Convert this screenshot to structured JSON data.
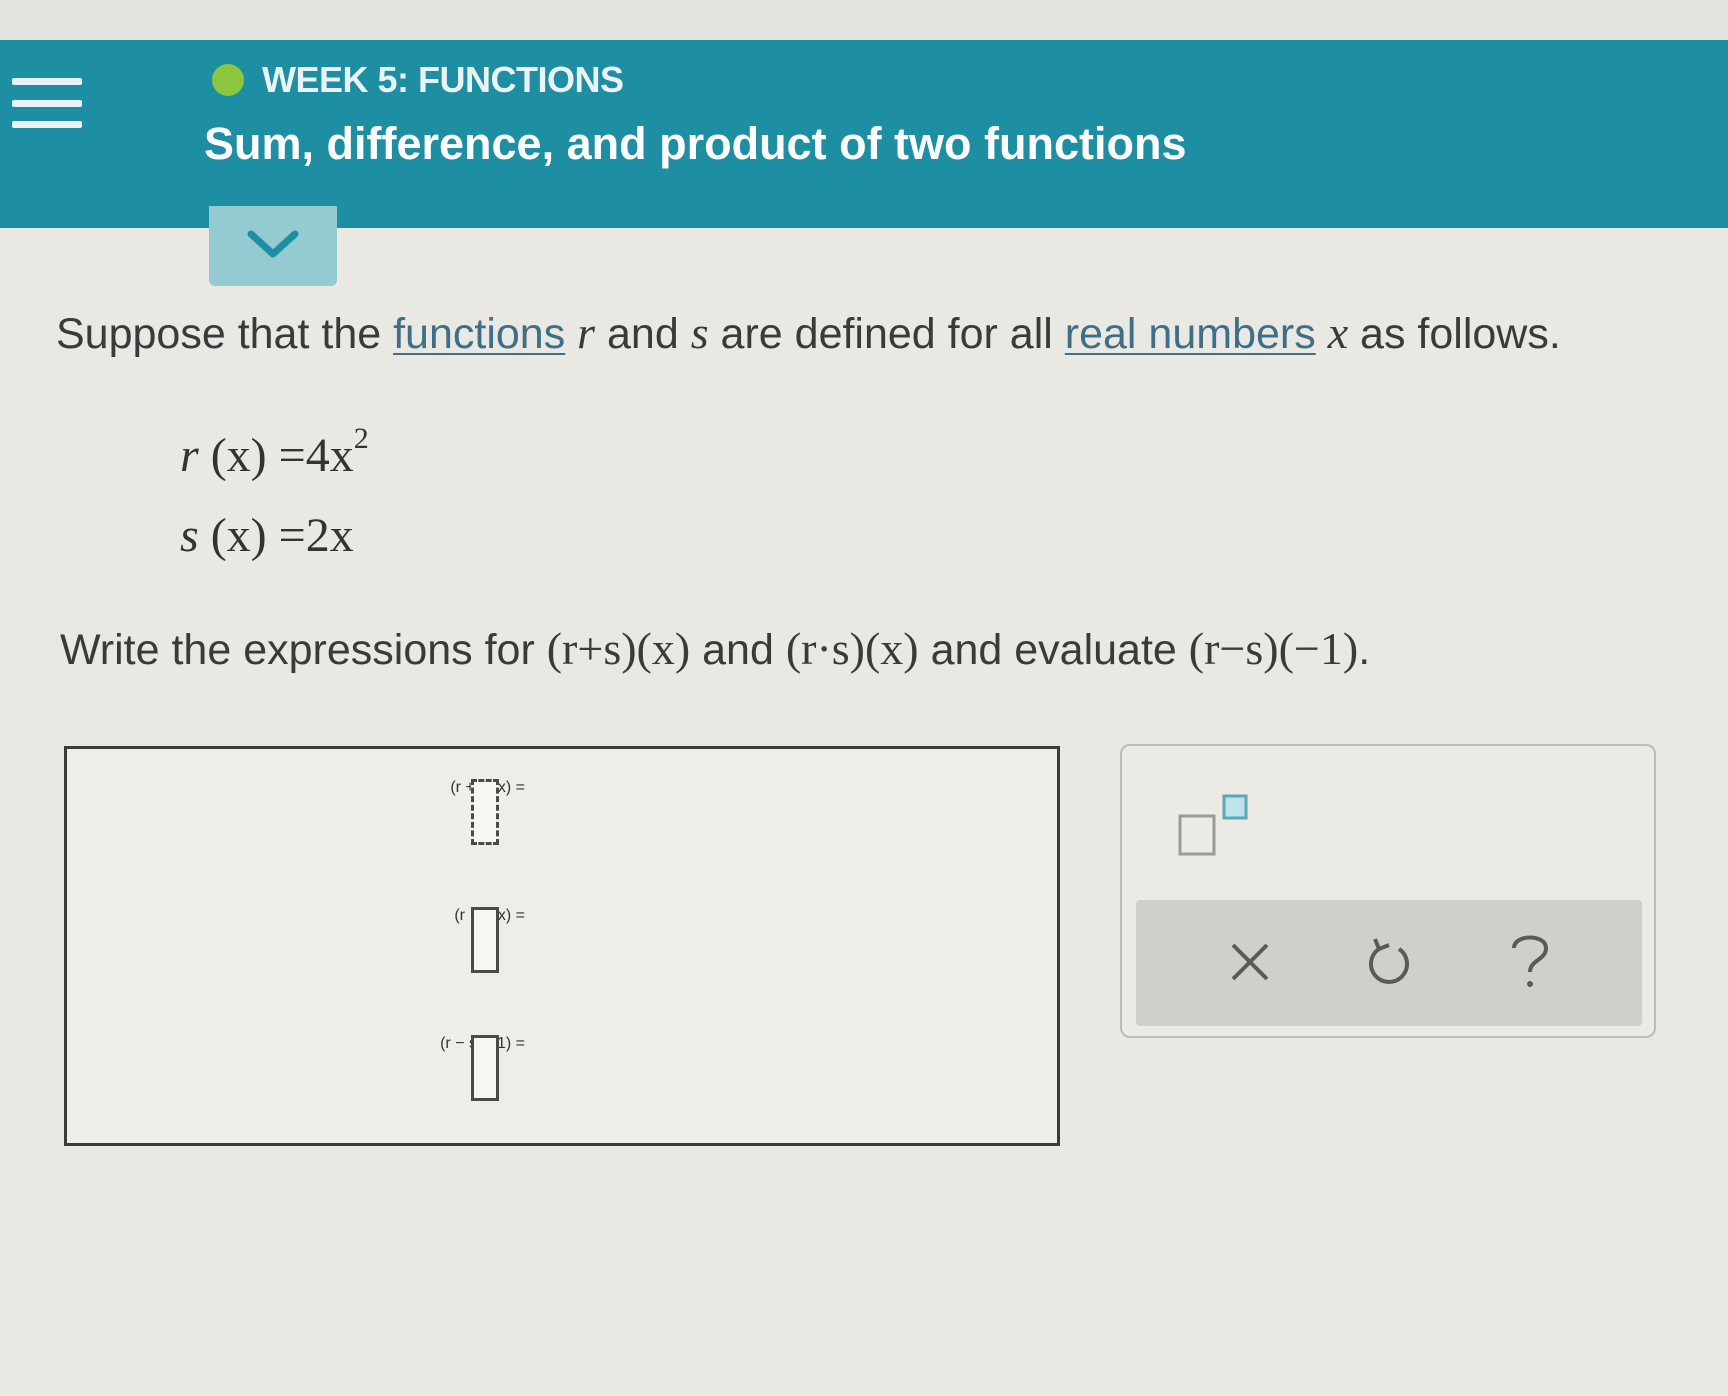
{
  "header": {
    "week_label": "WEEK 5: FUNCTIONS",
    "topic_title": "Sum, difference, and product of two functions",
    "status_color": "#8ec63f",
    "accent_color": "#1e8ea3"
  },
  "question": {
    "prompt_part1": "Suppose that the ",
    "prompt_link1": "functions",
    "prompt_var_r": "r",
    "prompt_part2": " and ",
    "prompt_var_s": "s",
    "prompt_part3": " are defined for all ",
    "prompt_link2": "real numbers",
    "prompt_var_x": "x",
    "prompt_part4": " as follows.",
    "definitions": [
      {
        "name": "r",
        "arg": "(x) =",
        "expr": "4x",
        "exponent": "2"
      },
      {
        "name": "s",
        "arg": "(x) =",
        "expr": "2x",
        "exponent": ""
      }
    ],
    "instruction_part1": "Write the expressions for ",
    "instruction_expr1": "(r+s)(x)",
    "instruction_part2": " and ",
    "instruction_expr2": "(r·s)(x)",
    "instruction_part3": " and evaluate ",
    "instruction_expr3": "(r−s)(−1)",
    "instruction_part4": "."
  },
  "answers": [
    {
      "lhs": "(r + s)(x) =",
      "value": ""
    },
    {
      "lhs": "(r · s)(x) =",
      "value": ""
    },
    {
      "lhs": "(r − s)(−1) =",
      "value": ""
    }
  ],
  "tools": {
    "exponent_icon": "exponent-template-icon",
    "clear_icon": "close-icon",
    "undo_icon": "undo-icon",
    "help_icon": "help-icon",
    "clear_label": "×",
    "help_label": "?"
  }
}
